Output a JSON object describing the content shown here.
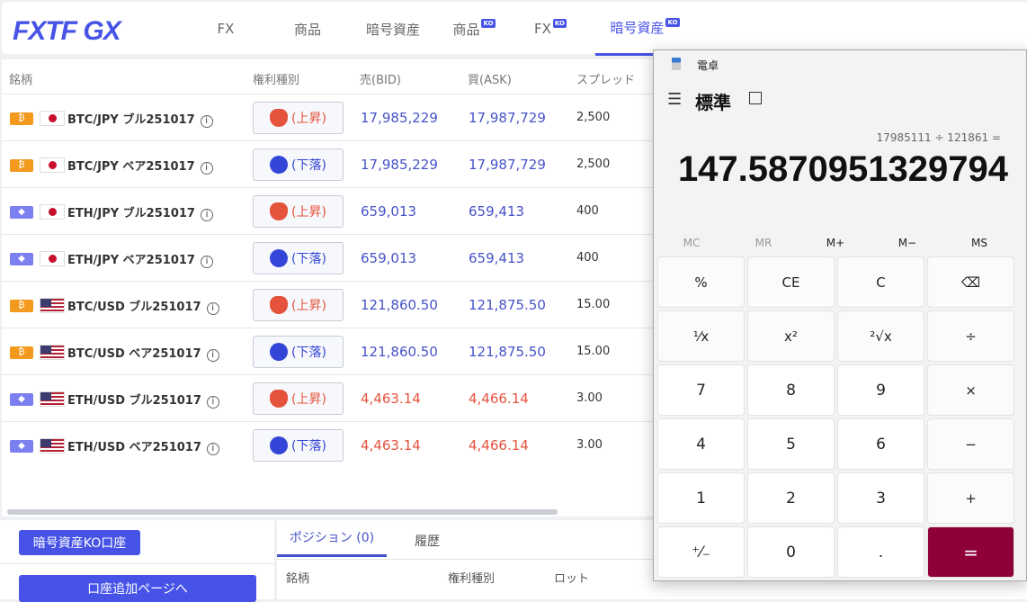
{
  "header": {
    "logo": "FXTF GX",
    "tabs": [
      {
        "label": "FX",
        "ko": ""
      },
      {
        "label": "商品",
        "ko": ""
      },
      {
        "label": "暗号資産",
        "ko": ""
      },
      {
        "label": "商品",
        "ko": "KO"
      },
      {
        "label": "FX",
        "ko": "KO"
      },
      {
        "label": "暗号資産",
        "ko": "KO"
      }
    ],
    "active_tab": 5
  },
  "table": {
    "headers": [
      "銘柄",
      "権利種別",
      "売(BID)",
      "買(ASK)",
      "スプレッド"
    ],
    "rows": [
      {
        "coin": "BTC",
        "flag": "jp",
        "name": "BTC/JPY ブル251017",
        "type": "(上昇)",
        "kind": "bull",
        "bid": "17,985,229",
        "ask": "17,987,729",
        "spread": "2,500",
        "color": "#4653c8"
      },
      {
        "coin": "BTC",
        "flag": "jp",
        "name": "BTC/JPY ベア251017",
        "type": "(下落)",
        "kind": "bear",
        "bid": "17,985,229",
        "ask": "17,987,729",
        "spread": "2,500",
        "color": "#4653c8"
      },
      {
        "coin": "ETH",
        "flag": "jp",
        "name": "ETH/JPY ブル251017",
        "type": "(上昇)",
        "kind": "bull",
        "bid": "659,013",
        "ask": "659,413",
        "spread": "400",
        "color": "#4653c8"
      },
      {
        "coin": "ETH",
        "flag": "jp",
        "name": "ETH/JPY ベア251017",
        "type": "(下落)",
        "kind": "bear",
        "bid": "659,013",
        "ask": "659,413",
        "spread": "400",
        "color": "#4653c8"
      },
      {
        "coin": "BTC",
        "flag": "us",
        "name": "BTC/USD ブル251017",
        "type": "(上昇)",
        "kind": "bull",
        "bid": "121,860.50",
        "ask": "121,875.50",
        "spread": "15.00",
        "color": "#4653c8"
      },
      {
        "coin": "BTC",
        "flag": "us",
        "name": "BTC/USD ベア251017",
        "type": "(下落)",
        "kind": "bear",
        "bid": "121,860.50",
        "ask": "121,875.50",
        "spread": "15.00",
        "color": "#4653c8"
      },
      {
        "coin": "ETH",
        "flag": "us",
        "name": "ETH/USD ブル251017",
        "type": "(上昇)",
        "kind": "bull",
        "bid": "4,463.14",
        "ask": "4,466.14",
        "spread": "3.00",
        "color": "#e5533d"
      },
      {
        "coin": "ETH",
        "flag": "us",
        "name": "ETH/USD ベア251017",
        "type": "(下落)",
        "kind": "bear",
        "bid": "4,463.14",
        "ask": "4,466.14",
        "spread": "3.00",
        "color": "#e5533d"
      }
    ]
  },
  "bottom": {
    "account_button": "暗号資産KO口座",
    "add_account_button": "口座追加ページへ",
    "tabs": [
      "ポジション (0)",
      "履歴"
    ],
    "headers": [
      "銘柄",
      "権利種別",
      "ロット"
    ]
  },
  "calculator": {
    "title": "電卓",
    "mode": "標準",
    "expression": "17985111 ÷ 121861 =",
    "display": "147.5870951329794",
    "memory": [
      "MC",
      "MR",
      "M+",
      "M−",
      "MS"
    ],
    "keys": [
      "%",
      "CE",
      "C",
      "⌫",
      "¹⁄x",
      "x²",
      "²√x",
      "÷",
      "7",
      "8",
      "9",
      "×",
      "4",
      "5",
      "6",
      "−",
      "1",
      "2",
      "3",
      "+",
      "⁺⁄₋",
      "0",
      ".",
      "="
    ]
  },
  "colors": {
    "accent": "#4653e6",
    "bull": "#e5533d",
    "bear": "#3346d8",
    "equals": "#8e0038"
  }
}
